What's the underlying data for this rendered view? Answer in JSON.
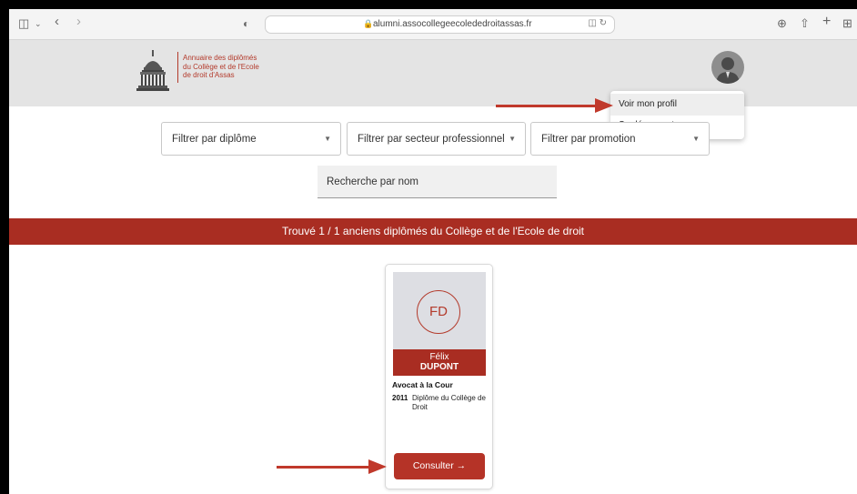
{
  "browser": {
    "url": "alumni.assocollegeecolededroitassas.fr",
    "icons": [
      "sidebar-icon",
      "chevron-down-icon",
      "back-icon",
      "forward-icon",
      "shield-icon",
      "lock-icon",
      "translate-icon",
      "reload-icon",
      "download-icon",
      "share-icon",
      "new-tab-icon",
      "tab-overview-icon"
    ]
  },
  "header": {
    "logo_line1": "Annuaire des diplômés",
    "logo_line2": "du Collège et de l'Ecole",
    "logo_line3": "de droit d'Assas"
  },
  "user_menu": {
    "items": [
      {
        "label": "Voir mon profil",
        "highlighted": true
      },
      {
        "label": "Se déconnecter",
        "highlighted": false
      }
    ]
  },
  "filters": {
    "diplome": "Filtrer par diplôme",
    "secteur": "Filtrer par secteur professionnel",
    "promotion": "Filtrer par promotion",
    "search_placeholder": "Recherche par nom"
  },
  "results": {
    "banner": "Trouvé 1 / 1 anciens diplômés du Collège et de l'Ecole de droit"
  },
  "card": {
    "initials": "FD",
    "first_name": "Félix",
    "last_name": "DUPONT",
    "profession": "Avocat à la Cour",
    "diploma_year": "2011",
    "diploma_name": "Diplôme du Collège de Droit",
    "button_label": "Consulter →"
  },
  "colors": {
    "brand_red": "#a92d22",
    "annotation_arrow": "#c0392b"
  }
}
